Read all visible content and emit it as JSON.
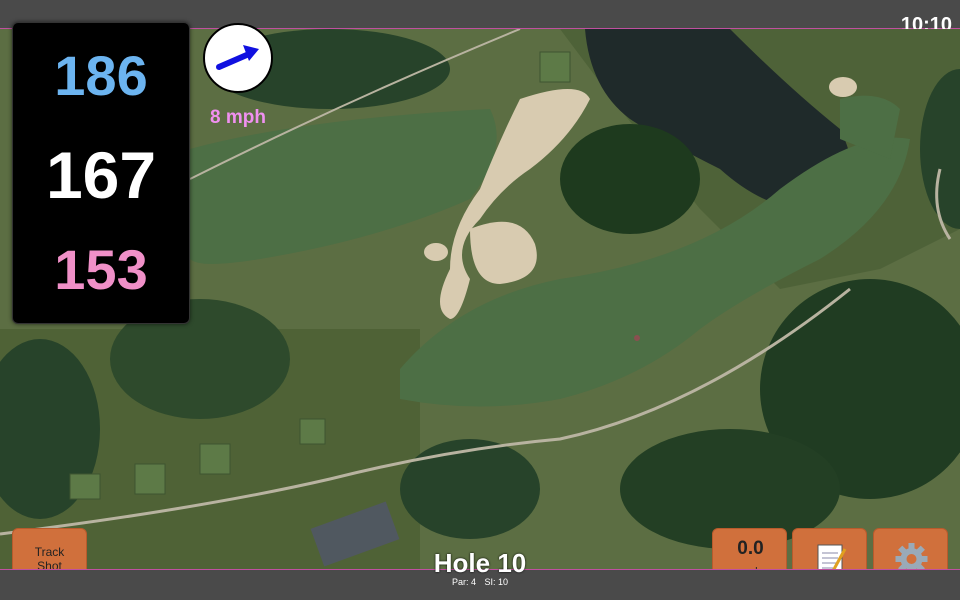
{
  "status": {
    "time": "10:10"
  },
  "distances": {
    "back": "186",
    "center": "167",
    "front": "153",
    "colors": {
      "back": "#6cb4f0",
      "center": "#ffffff",
      "front": "#f090c8"
    }
  },
  "wind": {
    "label": "8 mph",
    "icon": "wind-arrow-icon",
    "label_color": "#f090f0",
    "arrow_color": "#1010e0"
  },
  "buttons": {
    "track_shot": "Track\nShot",
    "speed_value": "0.0",
    "speed_unit": "mph",
    "notes_icon": "notepad-icon",
    "settings_icon": "gear-icon"
  },
  "hole": {
    "title": "Hole 10",
    "par": "Par: 4",
    "si": "SI: 10"
  },
  "colors": {
    "accent_button": "#d0703c",
    "border_accent": "#c050a0",
    "bar": "#4a4a4a"
  }
}
